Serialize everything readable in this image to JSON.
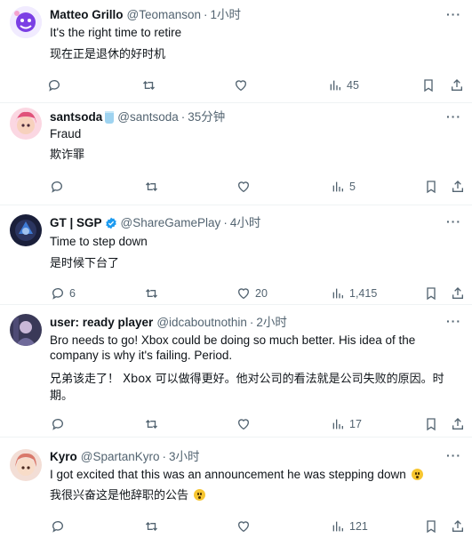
{
  "tweets": [
    {
      "name": "Matteo Grillo",
      "handle": "@Teomanson",
      "time": "1小时",
      "lines": [
        "It's the right time to retire",
        "现在正是退休的好时机"
      ],
      "replies": "",
      "likes": "",
      "views": "45",
      "avatar_color": "#7b3fe4"
    },
    {
      "name": "santsoda",
      "handle": "@santsoda",
      "time": "35分钟",
      "lines": [
        "Fraud",
        "欺诈罪"
      ],
      "replies": "",
      "likes": "",
      "views": "5",
      "avatar_color": "#e0527a"
    },
    {
      "name": "GT | SGP",
      "handle": "@ShareGamePlay",
      "time": "4小时",
      "lines": [
        "Time to step down",
        "是时候下台了"
      ],
      "replies": "6",
      "likes": "20",
      "views": "1,415",
      "avatar_color": "#1a1f3a"
    },
    {
      "name": "user: ready player",
      "handle": "@idcaboutnothin",
      "time": "2小时",
      "lines": [
        "Bro needs to go! Xbox could be doing so much better. His idea of the company is why it's failing. Period.",
        "兄弟该走了！ Xbox 可以做得更好。他对公司的看法就是公司失败的原因。时期。"
      ],
      "replies": "",
      "likes": "",
      "views": "17",
      "avatar_color": "#4b4a6e"
    },
    {
      "name": "Kyro",
      "handle": "@SpartanKyro",
      "time": "3小时",
      "lines": [
        "I got excited that this was an announcement he was stepping down",
        "我很兴奋这是他辞职的公告"
      ],
      "replies": "",
      "likes": "",
      "views": "121",
      "avatar_color": "#d9796b"
    }
  ],
  "more_label": "···",
  "dot": "·"
}
